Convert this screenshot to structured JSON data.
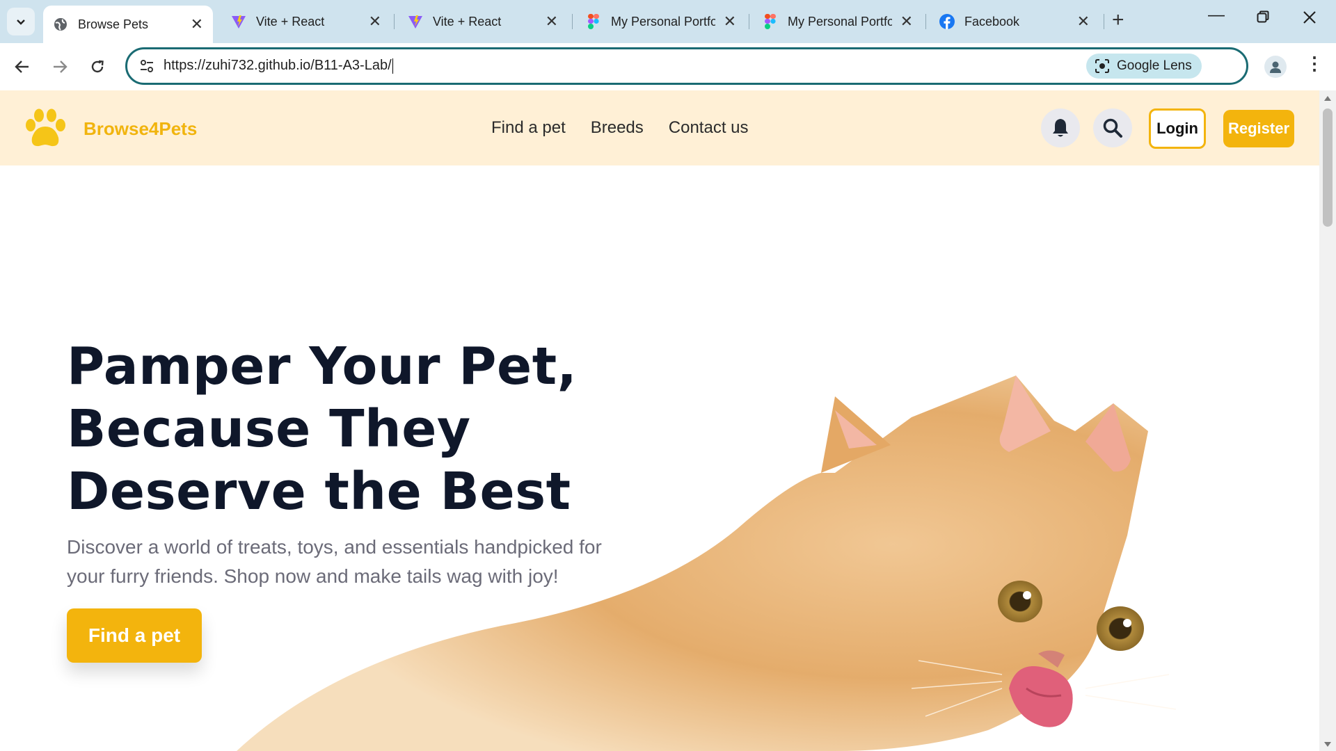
{
  "browser": {
    "tabs": [
      {
        "title": "Browse Pets",
        "icon": "globe-icon",
        "active": true
      },
      {
        "title": "Vite + React",
        "icon": "vite-icon",
        "active": false
      },
      {
        "title": "Vite + React",
        "icon": "vite-icon",
        "active": false
      },
      {
        "title": "My Personal Portfo",
        "icon": "figma-icon",
        "active": false
      },
      {
        "title": "My Personal Portfo",
        "icon": "figma-icon",
        "active": false
      },
      {
        "title": "Facebook",
        "icon": "facebook-icon",
        "active": false
      }
    ],
    "url": "https://zuhi732.github.io/B11-A3-Lab/",
    "lens_label": "Google Lens",
    "accent": "#1a6b73"
  },
  "site": {
    "brand": "Browse4Pets",
    "brand_color": "#f1b40e",
    "nav": [
      "Find a pet",
      "Breeds",
      "Contact us"
    ],
    "login_label": "Login",
    "register_label": "Register",
    "header_bg": "#fff0d6"
  },
  "hero": {
    "title_lines": [
      "Pamper Your Pet,",
      "Because They",
      "Deserve the Best"
    ],
    "description": "Discover a world of treats, toys, and essentials handpicked for your furry friends. Shop now and make tails wag with joy!",
    "cta_label": "Find a pet",
    "image_subject": "kitten-image"
  }
}
